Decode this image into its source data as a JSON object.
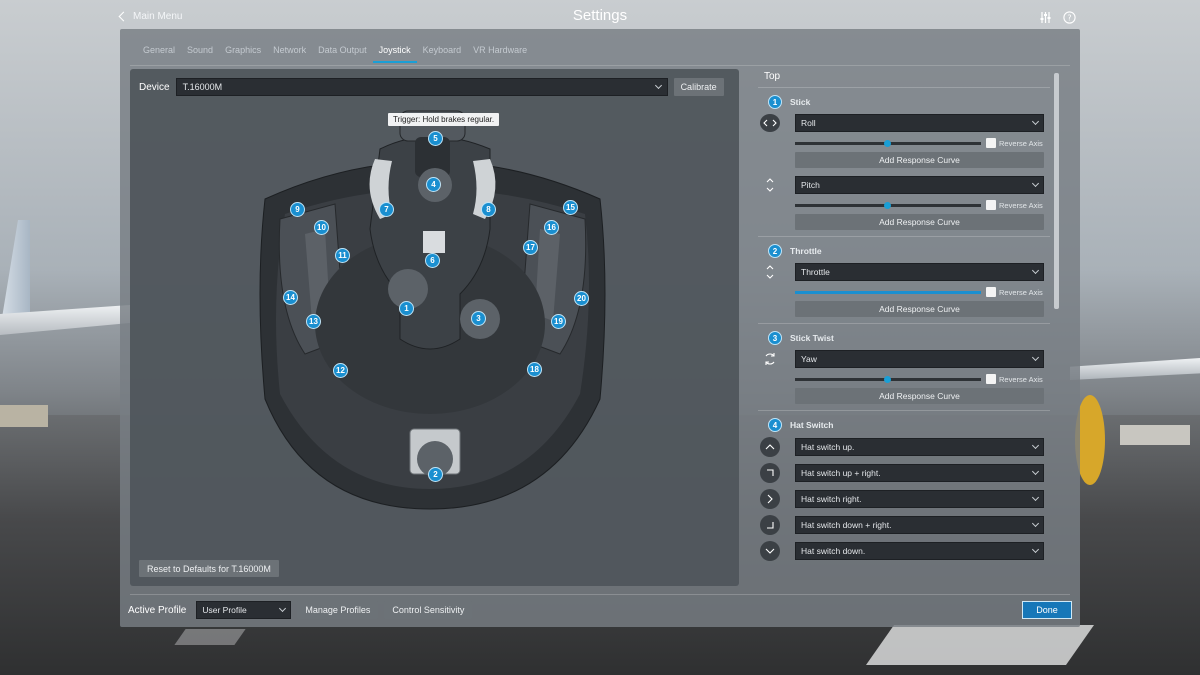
{
  "header": {
    "back_label": "Main Menu",
    "title": "Settings"
  },
  "tabs": [
    {
      "label": "General"
    },
    {
      "label": "Sound"
    },
    {
      "label": "Graphics"
    },
    {
      "label": "Network"
    },
    {
      "label": "Data Output"
    },
    {
      "label": "Joystick",
      "active": true
    },
    {
      "label": "Keyboard"
    },
    {
      "label": "VR Hardware"
    }
  ],
  "device": {
    "label": "Device",
    "value": "T.16000M",
    "calibrate_label": "Calibrate",
    "reset_label": "Reset to Defaults for T.16000M",
    "tooltip": "Trigger: Hold brakes regular.",
    "markers": [
      "5",
      "4",
      "7",
      "8",
      "9",
      "10",
      "11",
      "6",
      "15",
      "16",
      "17",
      "14",
      "1",
      "3",
      "13",
      "20",
      "19",
      "12",
      "18",
      "2"
    ]
  },
  "mapping": {
    "section_title": "Top",
    "reverse_label": "Reverse Axis",
    "curve_label": "Add Response Curve",
    "groups": {
      "stick": {
        "num": "1",
        "title": "Stick",
        "axis1": "Roll",
        "axis2": "Pitch",
        "slider1": 0.5,
        "slider2": 0.5
      },
      "throttle": {
        "num": "2",
        "title": "Throttle",
        "axis1": "Throttle",
        "slider1": 1.0
      },
      "twist": {
        "num": "3",
        "title": "Stick Twist",
        "axis1": "Yaw",
        "slider1": 0.5
      },
      "hat": {
        "num": "4",
        "title": "Hat Switch",
        "items": [
          "Hat switch up.",
          "Hat switch up + right.",
          "Hat switch right.",
          "Hat switch down + right.",
          "Hat switch down."
        ]
      }
    }
  },
  "footer": {
    "profile_label": "Active Profile",
    "profile_value": "User Profile",
    "manage_label": "Manage Profiles",
    "sensitivity_label": "Control Sensitivity",
    "done_label": "Done"
  },
  "colors": {
    "accent": "#1a8fd0",
    "panel": "#787e84",
    "field": "#2a2e33",
    "done": "#1677b8"
  }
}
